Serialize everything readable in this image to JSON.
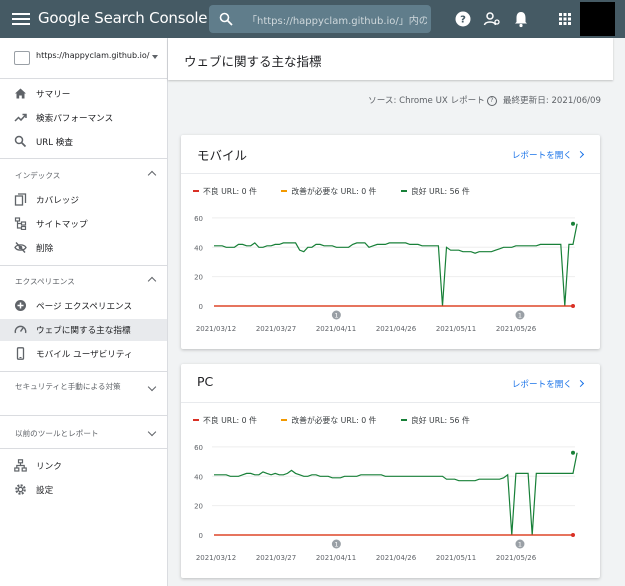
{
  "app": {
    "logo": "Google Search Console"
  },
  "search": {
    "text": "「https://happyclam.github.io/」内の"
  },
  "property": {
    "url": "https://happyclam.github.io/"
  },
  "sidebar": {
    "items": [
      {
        "label": "サマリー"
      },
      {
        "label": "検索パフォーマンス"
      },
      {
        "label": "URL 検査"
      }
    ],
    "index_section": {
      "label": "インデックス",
      "items": [
        {
          "label": "カバレッジ"
        },
        {
          "label": "サイトマップ"
        },
        {
          "label": "削除"
        }
      ]
    },
    "experience_section": {
      "label": "エクスペリエンス",
      "items": [
        {
          "label": "ページ エクスペリエンス"
        },
        {
          "label": "ウェブに関する主な指標"
        },
        {
          "label": "モバイル ユーザビリティ"
        }
      ]
    },
    "security_section": {
      "label": "セキュリティと手動による対策"
    },
    "legacy_section": {
      "label": "以前のツールとレポート"
    },
    "bottom_items": [
      {
        "label": "リンク"
      },
      {
        "label": "設定"
      }
    ]
  },
  "page": {
    "title": "ウェブに関する主な指標",
    "source": "ソース: Chrome UX レポート",
    "updated": "最終更新日: 2021/06/09"
  },
  "colors": {
    "bad": "#d93025",
    "needs_improvement": "#f29900",
    "good": "#188038",
    "link": "#1a73e8"
  },
  "legend": {
    "bad": "不良 URL: 0 件",
    "needs": "改善が必要な URL: 0 件",
    "good": "良好 URL: 56 件"
  },
  "cards": [
    {
      "title": "モバイル",
      "link": "レポートを開く"
    },
    {
      "title": "PC",
      "link": "レポートを開く"
    }
  ],
  "chart_data": [
    {
      "type": "line",
      "title": "モバイル",
      "x_labels": [
        "2021/03/12",
        "2021/03/27",
        "2021/04/11",
        "2021/04/26",
        "2021/05/11",
        "2021/05/26"
      ],
      "yticks": [
        0,
        20,
        40,
        60
      ],
      "ylim": [
        0,
        62
      ],
      "annotations": [
        {
          "x": 30,
          "label": "1"
        },
        {
          "x": 75,
          "label": "1"
        }
      ],
      "series": [
        {
          "key": "bad",
          "name": "不良 URL: 0 件",
          "color": "#d93025",
          "values": [
            0,
            0,
            0,
            0,
            0,
            0,
            0,
            0,
            0,
            0,
            0,
            0,
            0,
            0,
            0,
            0,
            0,
            0,
            0,
            0,
            0,
            0,
            0,
            0,
            0,
            0,
            0,
            0,
            0,
            0,
            0,
            0,
            0,
            0,
            0,
            0,
            0,
            0,
            0,
            0,
            0,
            0,
            0,
            0,
            0,
            0,
            0,
            0,
            0,
            0,
            0,
            0,
            0,
            0,
            0,
            0,
            0,
            0,
            0,
            0,
            0,
            0,
            0,
            0,
            0,
            0,
            0,
            0,
            0,
            0,
            0,
            0,
            0,
            0,
            0,
            0,
            0,
            0,
            0,
            0,
            0,
            0,
            0,
            0,
            0,
            0,
            0,
            0,
            0
          ]
        },
        {
          "key": "needs",
          "name": "改善が必要な URL: 0 件",
          "color": "#f29900",
          "values": [
            0,
            0,
            0,
            0,
            0,
            0,
            0,
            0,
            0,
            0,
            0,
            0,
            0,
            0,
            0,
            0,
            0,
            0,
            0,
            0,
            0,
            0,
            0,
            0,
            0,
            0,
            0,
            0,
            0,
            0,
            0,
            0,
            0,
            0,
            0,
            0,
            0,
            0,
            0,
            0,
            0,
            0,
            0,
            0,
            0,
            0,
            0,
            0,
            0,
            0,
            0,
            0,
            0,
            0,
            0,
            0,
            0,
            0,
            0,
            0,
            0,
            0,
            0,
            0,
            0,
            0,
            0,
            0,
            0,
            0,
            0,
            0,
            0,
            0,
            0,
            0,
            0,
            0,
            0,
            0,
            0,
            0,
            0,
            0,
            0,
            0,
            0,
            0,
            0
          ]
        },
        {
          "key": "good",
          "name": "良好 URL: 56 件",
          "color": "#188038",
          "values": [
            41,
            41,
            41,
            40,
            40,
            40,
            42,
            42,
            41,
            41,
            43,
            40,
            40,
            41,
            41,
            42,
            42,
            43,
            43,
            43,
            43,
            38,
            37,
            40,
            40,
            42,
            42,
            41,
            41,
            41,
            40,
            40,
            40,
            40,
            42,
            43,
            43,
            43,
            40,
            41,
            42,
            42,
            42,
            43,
            43,
            43,
            43,
            43,
            42,
            42,
            42,
            41,
            41,
            41,
            41,
            41,
            0,
            40,
            38,
            38,
            38,
            37,
            37,
            37,
            36,
            37,
            37,
            37,
            37,
            38,
            39,
            40,
            40,
            40,
            41,
            41,
            41,
            41,
            41,
            41,
            42,
            42,
            42,
            42,
            42,
            42,
            0,
            42,
            42,
            56
          ]
        }
      ]
    },
    {
      "type": "line",
      "title": "PC",
      "x_labels": [
        "2021/03/12",
        "2021/03/27",
        "2021/04/11",
        "2021/04/26",
        "2021/05/11",
        "2021/05/26"
      ],
      "yticks": [
        0,
        20,
        40,
        60
      ],
      "ylim": [
        0,
        62
      ],
      "annotations": [
        {
          "x": 30,
          "label": "1"
        },
        {
          "x": 75,
          "label": "1"
        }
      ],
      "series": [
        {
          "key": "bad",
          "name": "不良 URL: 0 件",
          "color": "#d93025",
          "values": [
            0,
            0,
            0,
            0,
            0,
            0,
            0,
            0,
            0,
            0,
            0,
            0,
            0,
            0,
            0,
            0,
            0,
            0,
            0,
            0,
            0,
            0,
            0,
            0,
            0,
            0,
            0,
            0,
            0,
            0,
            0,
            0,
            0,
            0,
            0,
            0,
            0,
            0,
            0,
            0,
            0,
            0,
            0,
            0,
            0,
            0,
            0,
            0,
            0,
            0,
            0,
            0,
            0,
            0,
            0,
            0,
            0,
            0,
            0,
            0,
            0,
            0,
            0,
            0,
            0,
            0,
            0,
            0,
            0,
            0,
            0,
            0,
            0,
            0,
            0,
            0,
            0,
            0,
            0,
            0,
            0,
            0,
            0,
            0,
            0,
            0,
            0,
            0,
            0
          ]
        },
        {
          "key": "needs",
          "name": "改善が必要な URL: 0 件",
          "color": "#f29900",
          "values": [
            0,
            0,
            0,
            0,
            0,
            0,
            0,
            0,
            0,
            0,
            0,
            0,
            0,
            0,
            0,
            0,
            0,
            0,
            0,
            0,
            0,
            0,
            0,
            0,
            0,
            0,
            0,
            0,
            0,
            0,
            0,
            0,
            0,
            0,
            0,
            0,
            0,
            0,
            0,
            0,
            0,
            0,
            0,
            0,
            0,
            0,
            0,
            0,
            0,
            0,
            0,
            0,
            0,
            0,
            0,
            0,
            0,
            0,
            0,
            0,
            0,
            0,
            0,
            0,
            0,
            0,
            0,
            0,
            0,
            0,
            0,
            0,
            0,
            0,
            0,
            0,
            0,
            0,
            0,
            0,
            0,
            0,
            0,
            0,
            0,
            0,
            0,
            0,
            0
          ]
        },
        {
          "key": "good",
          "name": "良好 URL: 56 件",
          "color": "#188038",
          "values": [
            41,
            41,
            41,
            41,
            40,
            40,
            40,
            41,
            42,
            42,
            41,
            41,
            43,
            42,
            41,
            42,
            41,
            41,
            42,
            44,
            42,
            41,
            40,
            40,
            41,
            41,
            40,
            40,
            40,
            39,
            39,
            39,
            40,
            40,
            40,
            40,
            41,
            41,
            41,
            41,
            41,
            41,
            40,
            40,
            40,
            40,
            40,
            40,
            40,
            40,
            40,
            40,
            40,
            40,
            40,
            40,
            40,
            38,
            38,
            38,
            37,
            37,
            37,
            37,
            37,
            38,
            38,
            38,
            38,
            38,
            38,
            39,
            41,
            0,
            42,
            42,
            42,
            42,
            0,
            42,
            42,
            42,
            42,
            42,
            42,
            42,
            42,
            42,
            42,
            56
          ]
        }
      ]
    }
  ]
}
